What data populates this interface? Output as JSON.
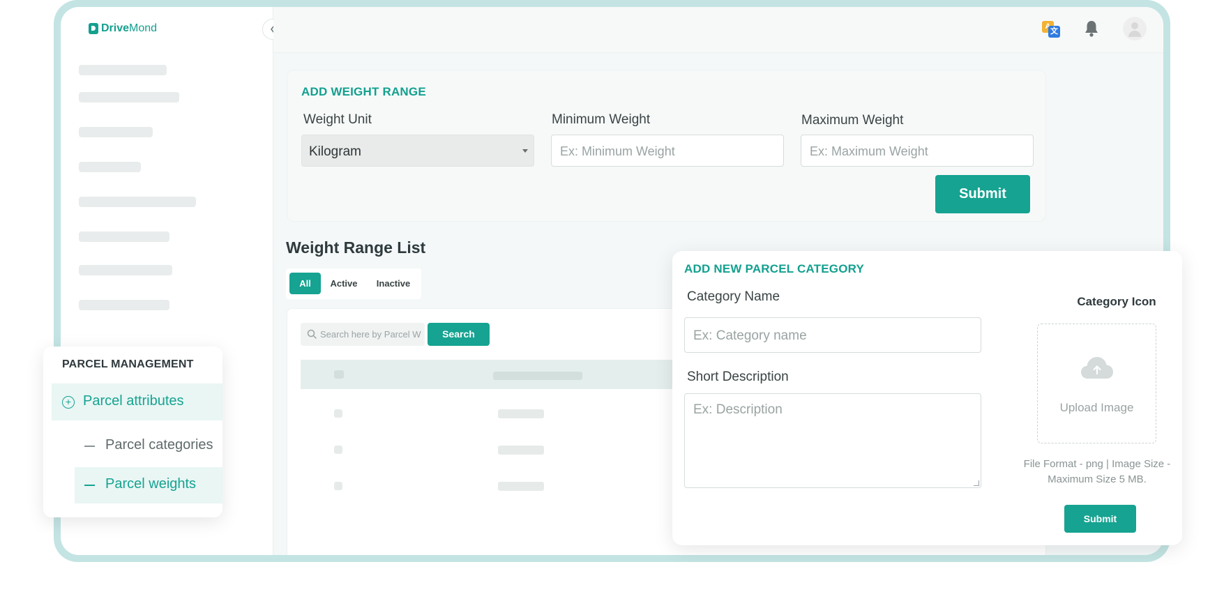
{
  "app": {
    "logo_part1": "Drive",
    "logo_part2": "Mond"
  },
  "topbar": {
    "icons": [
      "translate-icon",
      "bell-icon",
      "user-avatar-icon"
    ]
  },
  "weight_form": {
    "title": "ADD WEIGHT RANGE",
    "unit_label": "Weight Unit",
    "unit_value": "Kilogram",
    "min_label": "Minimum Weight",
    "min_placeholder": "Ex: Minimum Weight",
    "max_label": "Maximum Weight",
    "max_placeholder": "Ex: Maximum Weight",
    "submit_label": "Submit"
  },
  "weight_list": {
    "title": "Weight Range List",
    "filters": [
      "All",
      "Active",
      "Inactive"
    ],
    "search_placeholder": "Search here by Parcel W",
    "search_button": "Search"
  },
  "category_form": {
    "title": "ADD NEW PARCEL CATEGORY",
    "name_label": "Category Name",
    "name_placeholder": "Ex: Category name",
    "desc_label": "Short Description",
    "desc_placeholder": "Ex: Description",
    "icon_title": "Category Icon",
    "upload_label": "Upload Image",
    "hint_line1": "File Format - png | Image Size -",
    "hint_line2": "Maximum Size 5 MB.",
    "submit_label": "Submit"
  },
  "parcel_menu": {
    "title": "PARCEL MANAGEMENT",
    "attributes_label": "Parcel attributes",
    "items": [
      "Parcel categories",
      "Parcel weights"
    ]
  },
  "colors": {
    "accent": "#16a391",
    "frame": "#c3e4e3"
  }
}
